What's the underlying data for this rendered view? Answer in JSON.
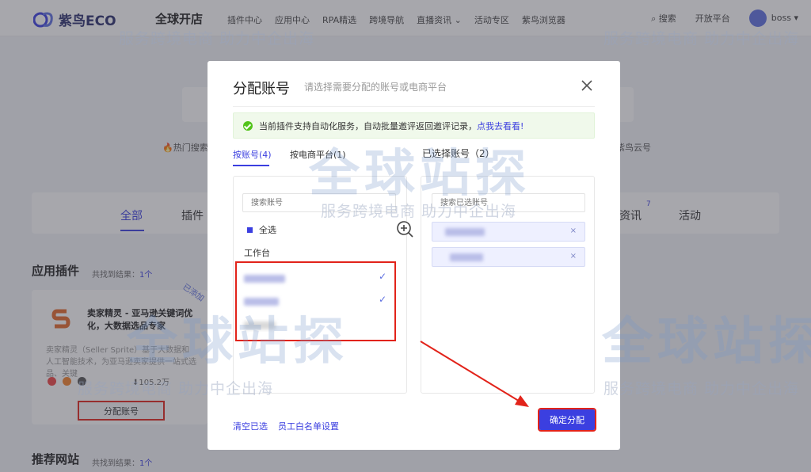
{
  "header": {
    "logo_text": "紫鸟ECO",
    "site_title": "全球开店",
    "nav": [
      "插件中心",
      "应用中心",
      "RPA精选",
      "跨境导航",
      "直播资讯",
      "活动专区",
      "紫鸟浏览器"
    ],
    "search_label": "搜索",
    "open_platform": "开放平台",
    "user": "boss"
  },
  "page": {
    "hot_label": "热门搜索",
    "hot_right": "紫鸟云号",
    "tabs": {
      "all": "全部",
      "plugin": "插件",
      "info": "资讯",
      "info_sup": "7",
      "activity": "活动"
    },
    "plugins_section": {
      "title": "应用插件",
      "count_prefix": "共找到结果：",
      "count": "1个"
    },
    "sites_section": {
      "title": "推荐网站",
      "count_prefix": "共找到结果：",
      "count": "1个"
    },
    "card": {
      "name": "卖家精灵 - 亚马逊关键词优化，大数据选品专家",
      "desc": "卖家精灵（Seller Sprite）基于大数据和人工智能技术，为亚马逊卖家提供一站式选品、关键",
      "badge": "已添加",
      "downloads": "105.2万",
      "assign_button": "分配账号"
    }
  },
  "modal": {
    "title": "分配账号",
    "subtitle": "请选择需要分配的账号或电商平台",
    "notice": "当前插件支持自动化服务，自动批量邀评返回邀评记录，",
    "notice_link": "点我去看看!",
    "tab_by_account": "按账号(4)",
    "tab_by_platform": "按电商平台(1)",
    "selected_header": "已选择账号（2）",
    "left_search_placeholder": "搜索账号",
    "right_search_placeholder": "搜索已选账号",
    "select_all": "全选",
    "group_label": "工作台",
    "clear_selected": "清空已选",
    "whitelist_settings": "员工白名单设置",
    "confirm": "确定分配"
  },
  "watermark": {
    "text1": "服务跨境电商 助力中企出海",
    "big": "全球站探"
  },
  "colors": {
    "accent": "#3b3fe0",
    "highlight": "#e2231a",
    "notice_bg": "#f0f9eb"
  }
}
